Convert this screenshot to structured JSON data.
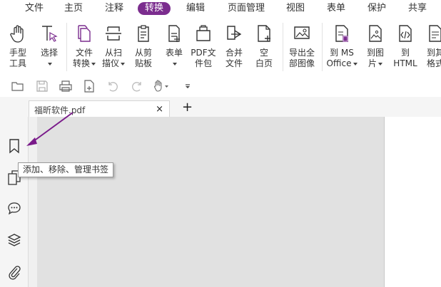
{
  "colors": {
    "accent": "#7b2d8e",
    "annotation_arrow": "#7a1a8a"
  },
  "menu": {
    "items": [
      {
        "label": "文件"
      },
      {
        "label": "主页"
      },
      {
        "label": "注释"
      },
      {
        "label": "转换",
        "active": true
      },
      {
        "label": "编辑"
      },
      {
        "label": "页面管理"
      },
      {
        "label": "视图"
      },
      {
        "label": "表单"
      },
      {
        "label": "保护"
      },
      {
        "label": "共享"
      }
    ]
  },
  "ribbon": {
    "hand_tool": {
      "label": "手型\n工具",
      "icon": "hand-icon"
    },
    "select_tool": {
      "label": "选择",
      "icon": "text-cursor-icon"
    },
    "file_convert": {
      "label": "文件\n转换",
      "icon": "file-icon"
    },
    "from_scanner": {
      "label": "从扫\n描仪",
      "icon": "scanner-icon"
    },
    "from_clipboard": {
      "label": "从剪\n贴板",
      "icon": "clipboard-icon"
    },
    "form": {
      "label": "表单",
      "icon": "form-icon"
    },
    "pdf_package": {
      "label": "PDF文\n件包",
      "icon": "package-icon"
    },
    "merge_files": {
      "label": "合并\n文件",
      "icon": "merge-icon"
    },
    "blank_page": {
      "label": "空\n白页",
      "icon": "blank-page-icon"
    },
    "export_images": {
      "label": "导出全\n部图像",
      "icon": "export-images-icon"
    },
    "to_ms_office": {
      "label": "到 MS\nOffice",
      "icon": "office-icon"
    },
    "to_image": {
      "label": "到图\n片",
      "icon": "image-icon"
    },
    "to_html": {
      "label": "到\nHTML",
      "icon": "html-icon"
    },
    "to_other": {
      "label": "到其\n格式",
      "icon": "other-format-icon"
    }
  },
  "quick_access": [
    "open-folder-icon",
    "save-icon",
    "print-icon",
    "new-file-icon",
    "undo-icon",
    "redo-icon",
    "hand-dropdown-icon",
    "customize-icon"
  ],
  "document_tab": {
    "label": "福昕软件.pdf",
    "close": "×"
  },
  "new_tab_label": "+",
  "sidebar": [
    "bookmark-icon",
    "pages-icon",
    "comment-icon",
    "layers-icon",
    "attachment-icon"
  ],
  "tooltip": {
    "text": "添加、移除、管理书签"
  }
}
